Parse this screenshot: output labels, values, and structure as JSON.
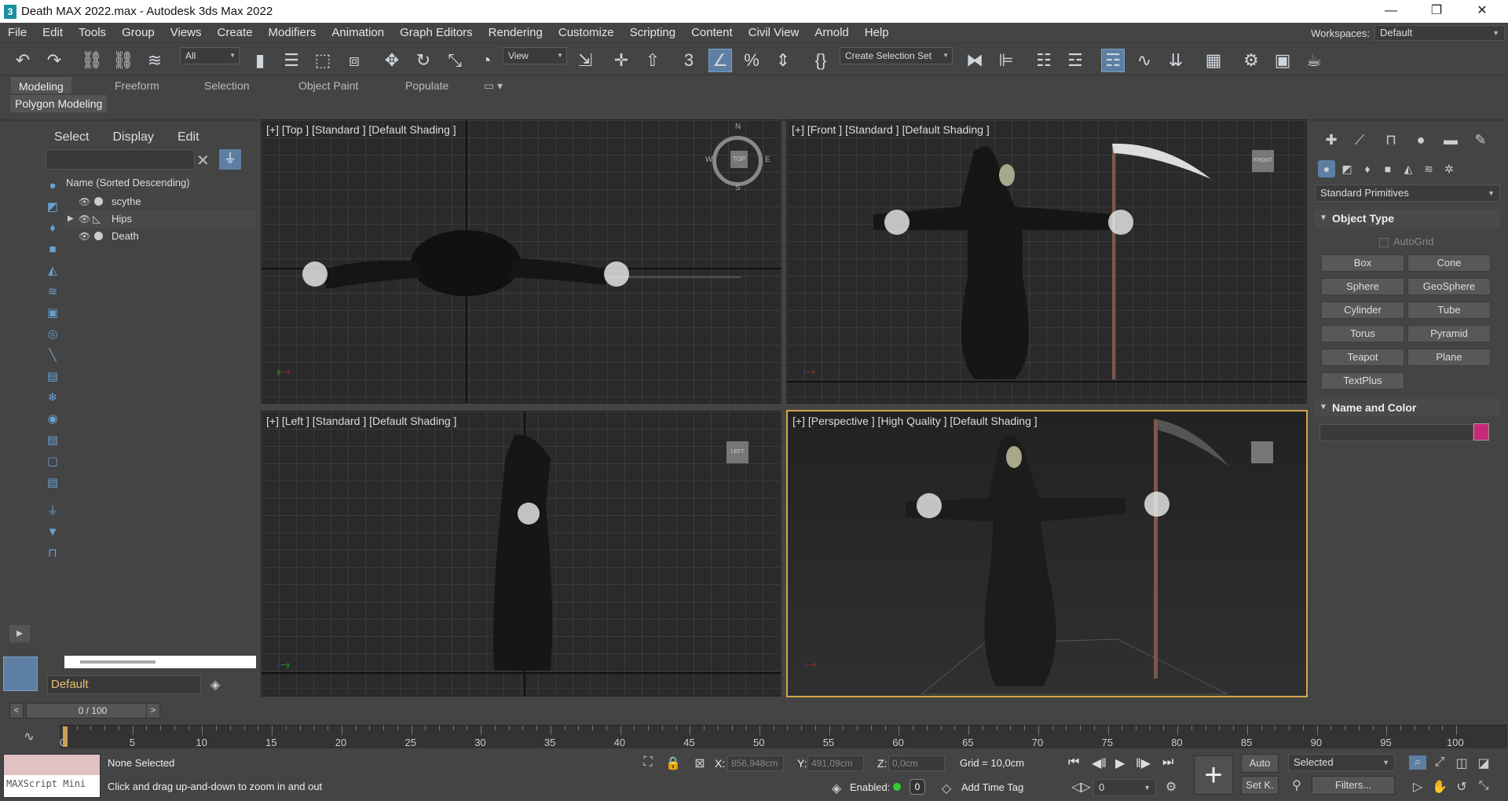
{
  "window": {
    "title": "Death MAX 2022.max - Autodesk 3ds Max 2022",
    "app_icon": "3"
  },
  "menu": [
    "File",
    "Edit",
    "Tools",
    "Group",
    "Views",
    "Create",
    "Modifiers",
    "Animation",
    "Graph Editors",
    "Rendering",
    "Customize",
    "Scripting",
    "Content",
    "Civil View",
    "Arnold",
    "Help"
  ],
  "workspaces": {
    "label": "Workspaces:",
    "value": "Default"
  },
  "toolbar": {
    "filter_value": "All",
    "ref_coord_value": "View",
    "selection_set_value": "Create Selection Set"
  },
  "ribbon": {
    "tabs": [
      "Modeling",
      "Freeform",
      "Selection",
      "Object Paint",
      "Populate"
    ],
    "active": "Modeling",
    "subpanel": "Polygon Modeling"
  },
  "scene_explorer": {
    "menu": [
      "Select",
      "Display",
      "Edit"
    ],
    "column_header": "Name (Sorted Descending)",
    "rows": [
      {
        "name": "scythe",
        "type": "geometry"
      },
      {
        "name": "Hips",
        "type": "bone"
      },
      {
        "name": "Death",
        "type": "geometry"
      }
    ],
    "layer": "Default"
  },
  "viewports": {
    "top": "[+] [Top ] [Standard ] [Default Shading ]",
    "front": "[+] [Front ] [Standard ] [Default Shading ]",
    "left": "[+] [Left ] [Standard ] [Default Shading ]",
    "perspective": "[+] [Perspective ] [High Quality ] [Default Shading ]",
    "viewcube": {
      "top": "TOP",
      "front": "FRONT",
      "left": "LEFT"
    },
    "compass": {
      "n": "N",
      "s": "S",
      "e": "E",
      "w": "W"
    }
  },
  "command_panel": {
    "category": "Standard Primitives",
    "object_type_title": "Object Type",
    "autogrid": "AutoGrid",
    "buttons": [
      "Box",
      "Cone",
      "Sphere",
      "GeoSphere",
      "Cylinder",
      "Tube",
      "Torus",
      "Pyramid",
      "Teapot",
      "Plane",
      "TextPlus"
    ],
    "name_color_title": "Name and Color",
    "color": "#c8287a"
  },
  "timeline": {
    "frame": "0 / 100",
    "ruler": [
      "0",
      "5",
      "10",
      "15",
      "20",
      "25",
      "30",
      "35",
      "40",
      "45",
      "50",
      "55",
      "60",
      "65",
      "70",
      "75",
      "80",
      "85",
      "90",
      "95",
      "100"
    ]
  },
  "status": {
    "maxscript": "MAXScript Mini",
    "selection": "None Selected",
    "prompt": "Click and drag up-and-down to zoom in and out",
    "x": "856,948cm",
    "y": "491,09cm",
    "z": "0,0cm",
    "grid": "Grid = 10,0cm",
    "enabled": "Enabled:",
    "time_tag": "Add Time Tag",
    "auto": "Auto",
    "setk": "Set K.",
    "key_filter": "Selected",
    "filters": "Filters...",
    "frame_value": "0"
  }
}
